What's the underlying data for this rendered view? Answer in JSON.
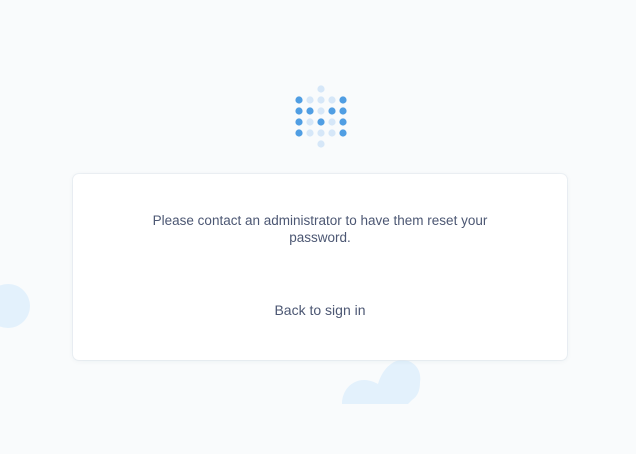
{
  "brand": {
    "logo_icon": "metabase-logo-icon",
    "dot_dark": "#509ee3",
    "dot_light": "#d6e7f8"
  },
  "card": {
    "message": "Please contact an administrator to have them reset your password.",
    "back_link": "Back to sign in"
  },
  "colors": {
    "background": "#f9fbfc",
    "card": "#ffffff",
    "text": "#4c5773",
    "cloud": "#e3f1fc"
  }
}
